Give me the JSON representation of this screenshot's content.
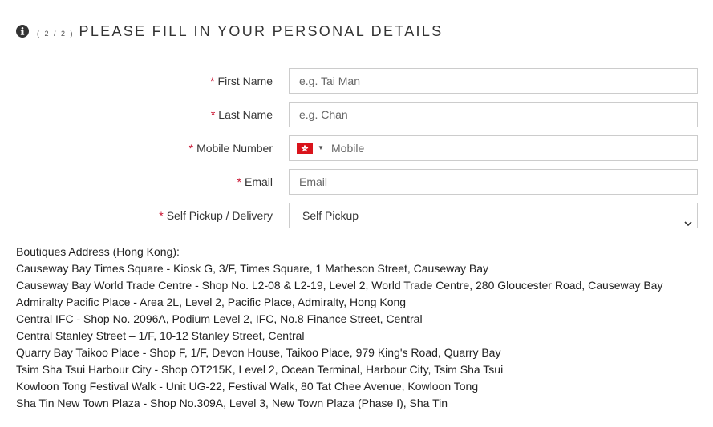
{
  "header": {
    "step": "( 2 / 2 )",
    "title": "PLEASE FILL IN YOUR PERSONAL DETAILS",
    "icon": "info-icon"
  },
  "form": {
    "required_mark": "*",
    "first_name": {
      "label": "First Name",
      "placeholder": "e.g. Tai Man"
    },
    "last_name": {
      "label": "Last Name",
      "placeholder": "e.g. Chan"
    },
    "mobile": {
      "label": "Mobile Number",
      "placeholder": "Mobile",
      "country_flag": "hong-kong-flag"
    },
    "email": {
      "label": "Email",
      "placeholder": "Email"
    },
    "delivery": {
      "label": "Self Pickup / Delivery",
      "selected": "Self Pickup"
    }
  },
  "boutiques": {
    "heading": "Boutiques Address (Hong Kong):",
    "items": [
      "Causeway Bay Times Square - Kiosk G, 3/F, Times Square, 1 Matheson Street, Causeway Bay",
      "Causeway Bay World Trade Centre - Shop No. L2-08 & L2-19, Level 2, World Trade Centre, 280 Gloucester Road, Causeway Bay",
      "Admiralty Pacific Place - Area 2L, Level 2, Pacific Place, Admiralty, Hong Kong",
      "Central IFC - Shop No. 2096A, Podium Level 2, IFC, No.8 Finance Street, Central",
      "Central Stanley Street – 1/F, 10-12 Stanley Street, Central",
      "Quarry Bay Taikoo Place - Shop F, 1/F, Devon House, Taikoo Place, 979 King's Road, Quarry Bay",
      "Tsim Sha Tsui Harbour City - Shop OT215K, Level 2, Ocean Terminal, Harbour City, Tsim Sha Tsui",
      "Kowloon Tong Festival Walk - Unit UG-22, Festival Walk, 80 Tat Chee Avenue, Kowloon Tong",
      "Sha Tin New Town Plaza - Shop No.309A, Level 3, New Town Plaza (Phase I), Sha Tin"
    ]
  },
  "colors": {
    "required": "#c8102e",
    "border": "#cccccc",
    "flag_red": "#d9131b"
  }
}
